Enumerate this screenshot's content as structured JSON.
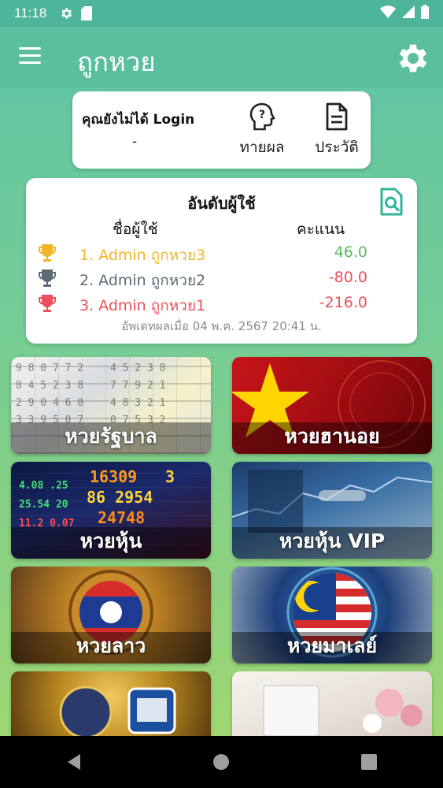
{
  "status_bar": {
    "time": "11:18"
  },
  "app_bar": {
    "title": "ถูกหวย"
  },
  "login_card": {
    "status_text": "คุณยังไม่ได้ Login",
    "user_value": "-",
    "predict_label": "ทายผล",
    "history_label": "ประวัติ"
  },
  "ranking": {
    "title": "อันดับผู้ใช้",
    "col_user": "ชื่อผู้ใช้",
    "col_score": "คะแนน",
    "rows": [
      {
        "name": "1. Admin ถูกหวย3",
        "score": "46.0",
        "name_color": "#f0b52a",
        "score_color": "#5cb85c",
        "trophy_color": "#f0b52a"
      },
      {
        "name": "2. Admin ถูกหวย2",
        "score": "-80.0",
        "name_color": "#5b6a78",
        "score_color": "#e8525a",
        "trophy_color": "#5b6a78"
      },
      {
        "name": "3. Admin ถูกหวย1",
        "score": "-216.0",
        "name_color": "#e8525a",
        "score_color": "#e8525a",
        "trophy_color": "#e8525a"
      }
    ],
    "updated": "อัพเดทผลเมื่อ 04 พ.ค. 2567 20:41 น."
  },
  "tiles": [
    {
      "label": "หวยรัฐบาล"
    },
    {
      "label": "หวยฮานอย"
    },
    {
      "label": "หวยหุ้น"
    },
    {
      "label": "หวยหุ้น VIP"
    },
    {
      "label": "หวยลาว"
    },
    {
      "label": "หวยมาเลย์"
    },
    {
      "label": ""
    },
    {
      "label": ""
    }
  ],
  "colors": {
    "accent": "#5bbf9f",
    "status_bar": "#4fb59a"
  }
}
